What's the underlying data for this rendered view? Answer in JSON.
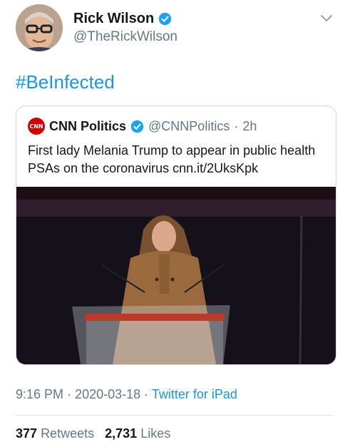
{
  "author": {
    "name": "Rick Wilson",
    "handle": "@TheRickWilson"
  },
  "tweet": {
    "text": "#BeInfected",
    "time": "9:16 PM",
    "date": "2020-03-18",
    "source": "Twitter for iPad",
    "separator": "·"
  },
  "quoted": {
    "logo_text": "CNN",
    "name": "CNN Politics",
    "handle": "@CNNPolitics",
    "age": "2h",
    "text": "First lady Melania Trump to appear in public health PSAs on the coronavirus cnn.it/2UksKpk"
  },
  "stats": {
    "retweets_count": "377",
    "retweets_label": "Retweets",
    "likes_count": "2,731",
    "likes_label": "Likes"
  },
  "icons": {
    "verified": "verified-badge-icon",
    "menu": "chevron-down-icon"
  },
  "colors": {
    "link": "#1b95e0",
    "verified": "#1da1f2",
    "muted": "#657786",
    "cnn_red": "#cc0000"
  }
}
